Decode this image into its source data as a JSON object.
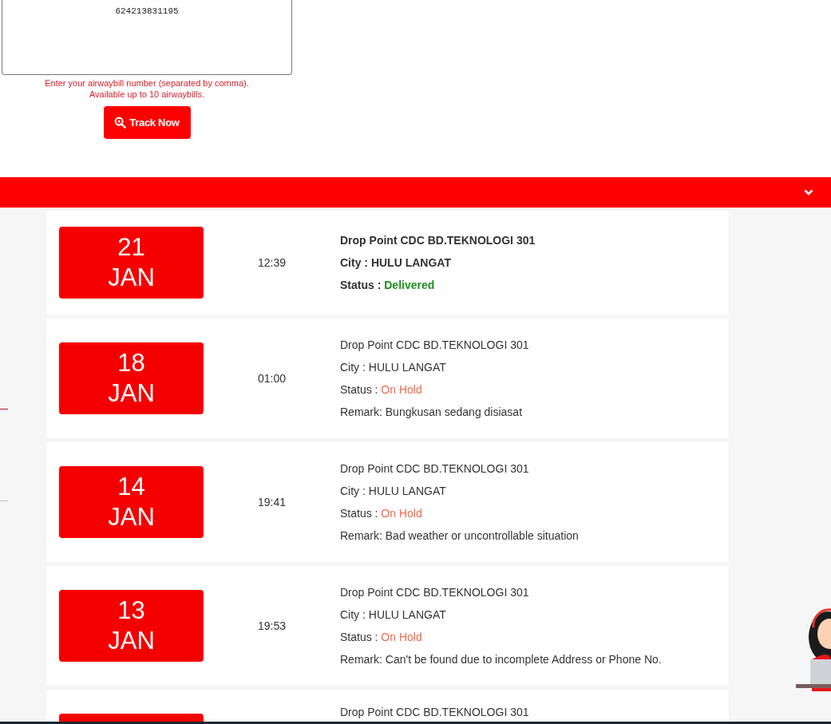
{
  "tracking": {
    "value": "624213831195",
    "hint": [
      "Enter your airwaybill number (separated by comma).",
      "Available up to 10 airwaybills."
    ],
    "button": "Track Now"
  },
  "results_bar": {
    "expanded": true
  },
  "events": [
    {
      "day": "21",
      "month": "JAN",
      "time": "12:39",
      "location": "Drop Point CDC BD.TEKNOLOGI 301",
      "city": "City : HULU LANGAT",
      "status_label": "Status :",
      "status": "Delivered",
      "color": "#1e8f1e",
      "latest": true
    },
    {
      "day": "18",
      "month": "JAN",
      "time": "01:00",
      "location": "Drop Point CDC BD.TEKNOLOGI 301",
      "city": "City : HULU LANGAT",
      "status_label": "Status :",
      "status": "On Hold",
      "color": "#f26a4b",
      "latest": false,
      "remark": "Remark: Bungkusan sedang disiasat"
    },
    {
      "day": "14",
      "month": "JAN",
      "time": "19:41",
      "location": "Drop Point CDC BD.TEKNOLOGI 301",
      "city": "City : HULU LANGAT",
      "status_label": "Status :",
      "status": "On Hold",
      "color": "#f26a4b",
      "latest": false,
      "remark": "Remark: Bad weather or uncontrollable situation"
    },
    {
      "day": "13",
      "month": "JAN",
      "time": "19:53",
      "location": "Drop Point CDC BD.TEKNOLOGI 301",
      "city": "City : HULU LANGAT",
      "status_label": "Status :",
      "status": "On Hold",
      "color": "#f26a4b",
      "latest": false,
      "remark": "Remark: Can't be found due to incomplete Address or Phone No."
    },
    {
      "location": "Drop Point CDC BD.TEKNOLOGI 301",
      "latest": false
    }
  ]
}
